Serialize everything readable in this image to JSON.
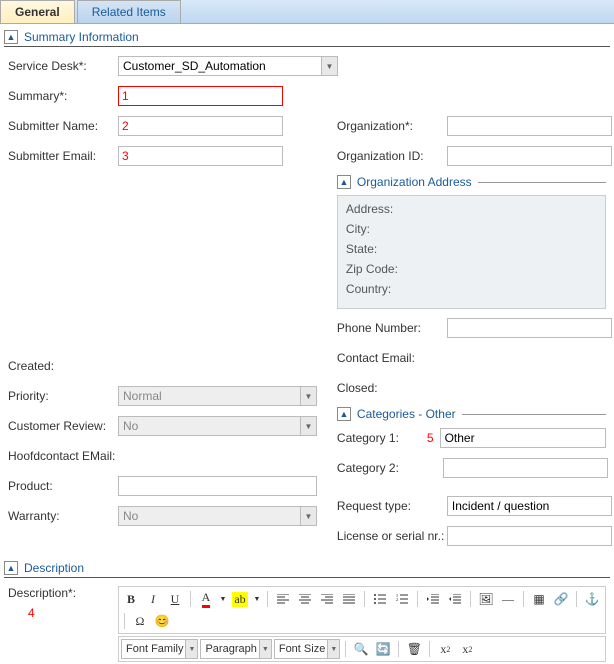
{
  "tabs": {
    "general": "General",
    "related": "Related Items"
  },
  "sections": {
    "summary": "Summary Information",
    "orgaddr": "Organization Address",
    "categories": "Categories - Other",
    "description": "Description"
  },
  "labels": {
    "service_desk": "Service Desk*:",
    "summary": "Summary*:",
    "submitter_name": "Submitter Name:",
    "submitter_email": "Submitter Email:",
    "organization": "Organization*:",
    "organization_id": "Organization ID:",
    "address": "Address:",
    "city": "City:",
    "state": "State:",
    "zip": "Zip Code:",
    "country": "Country:",
    "phone": "Phone Number:",
    "contact_email": "Contact Email:",
    "created": "Created:",
    "closed": "Closed:",
    "priority": "Priority:",
    "customer_review": "Customer Review:",
    "hoofdcontact": "Hoofdcontact EMail:",
    "product": "Product:",
    "warranty": "Warranty:",
    "category1": "Category 1:",
    "category2": "Category 2:",
    "request_type": "Request type:",
    "license": "License or serial nr.:",
    "description_field": "Description*:"
  },
  "values": {
    "service_desk": "Customer_SD_Automation",
    "priority": "Normal",
    "customer_review": "No",
    "warranty": "No",
    "category1": "Other",
    "request_type": "Incident / question",
    "font_family": "Font Family",
    "paragraph": "Paragraph",
    "font_size": "Font Size"
  },
  "markers": {
    "m1": "1",
    "m2": "2",
    "m3": "3",
    "m4": "4",
    "m5": "5"
  }
}
